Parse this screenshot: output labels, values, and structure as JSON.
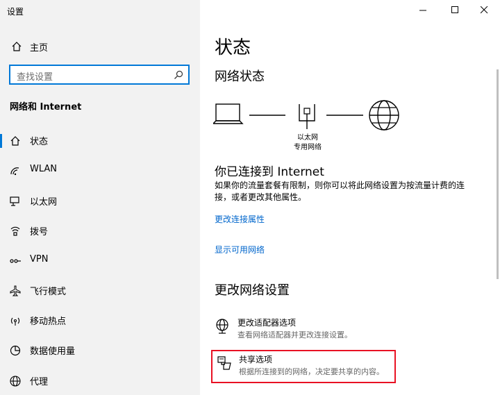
{
  "window": {
    "title": "设置"
  },
  "sidebar": {
    "home_label": "主页",
    "search_placeholder": "查找设置",
    "section_title": "网络和 Internet",
    "items": [
      {
        "label": "状态",
        "icon": "home-status-icon",
        "active": true
      },
      {
        "label": "WLAN",
        "icon": "wifi-icon"
      },
      {
        "label": "以太网",
        "icon": "ethernet-icon"
      },
      {
        "label": "拨号",
        "icon": "dialup-icon"
      },
      {
        "label": "VPN",
        "icon": "vpn-icon"
      },
      {
        "label": "飞行模式",
        "icon": "airplane-icon"
      },
      {
        "label": "移动热点",
        "icon": "hotspot-icon"
      },
      {
        "label": "数据使用量",
        "icon": "data-usage-icon"
      },
      {
        "label": "代理",
        "icon": "globe-icon"
      }
    ]
  },
  "main": {
    "page_title": "状态",
    "network_status_heading": "网络状态",
    "diagram_label_line1": "以太网",
    "diagram_label_line2": "专用网络",
    "connected_title": "你已连接到 Internet",
    "connected_desc": "如果你的流量套餐有限制，则你可以将此网络设置为按流量计费的连接，或者更改其他属性。",
    "link_change_props": "更改连接属性",
    "link_show_networks": "显示可用网络",
    "change_settings_heading": "更改网络设置",
    "options": [
      {
        "title": "更改适配器选项",
        "desc": "查看网络适配器并更改连接设置。",
        "icon": "adapter-globe-icon"
      },
      {
        "title": "共享选项",
        "desc": "根据所连接到的网络，决定要共享的内容。",
        "icon": "sharing-icon"
      }
    ]
  },
  "colors": {
    "accent": "#0078d7",
    "link": "#0066cc",
    "highlight_border": "#e81123"
  }
}
